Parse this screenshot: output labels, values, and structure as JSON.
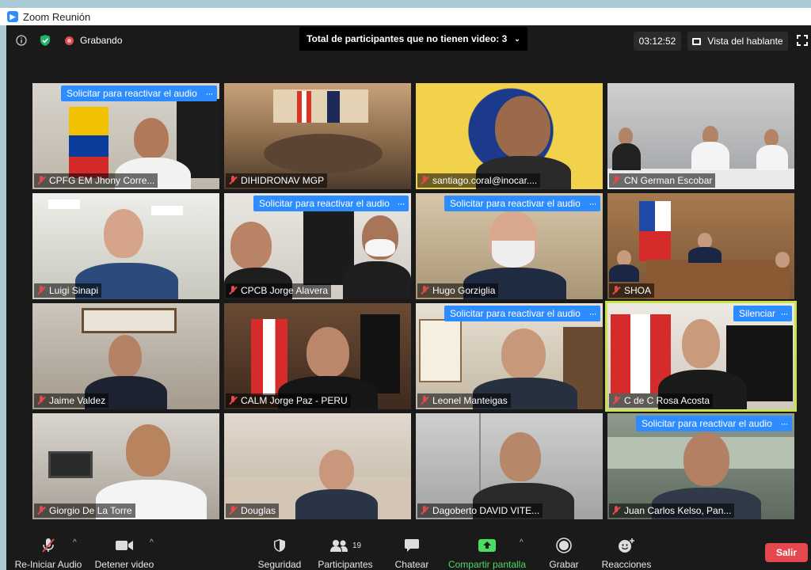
{
  "window": {
    "title": "Zoom Reunión"
  },
  "topbar": {
    "recording": "Grabando",
    "notice": "Total de participantes que no tienen video: 3",
    "timer": "03:12:52",
    "view": "Vista del hablante"
  },
  "participants": [
    {
      "name": "CPFG EM Jhony Corre...",
      "request": "Solicitar para reactivar el audio"
    },
    {
      "name": "DIHIDRONAV MGP"
    },
    {
      "name": "santiago.coral@inocar...."
    },
    {
      "name": "CN German Escobar"
    },
    {
      "name": "Luigi Sinapi"
    },
    {
      "name": "CPCB Jorge Alavera",
      "request": "Solicitar para reactivar el audio"
    },
    {
      "name": "Hugo Gorziglia",
      "request": "Solicitar para reactivar el audio"
    },
    {
      "name": "SHOA"
    },
    {
      "name": "Jaime Valdez"
    },
    {
      "name": "CALM Jorge Paz - PERU"
    },
    {
      "name": "Leonel Manteigas",
      "request": "Solicitar para reactivar el audio"
    },
    {
      "name": "C de C Rosa Acosta",
      "action": "Silenciar",
      "active": true
    },
    {
      "name": "Giorgio De La Torre"
    },
    {
      "name": "Douglas"
    },
    {
      "name": "Dagoberto DAVID VITE..."
    },
    {
      "name": "Juan Carlos Kelso, Pan...",
      "request": "Solicitar para reactivar el audio"
    }
  ],
  "toolbar": {
    "audio": "Re-Iniciar Audio",
    "video": "Detener video",
    "security": "Seguridad",
    "participants": "Participantes",
    "participants_count": "19",
    "chat": "Chatear",
    "share": "Compartir pantalla",
    "record": "Grabar",
    "reactions": "Reacciones",
    "leave": "Salir"
  },
  "colors": {
    "accent": "#2d8cff",
    "leave": "#e5484d",
    "share": "#4ddc62",
    "active_border": "#c9e34a"
  }
}
